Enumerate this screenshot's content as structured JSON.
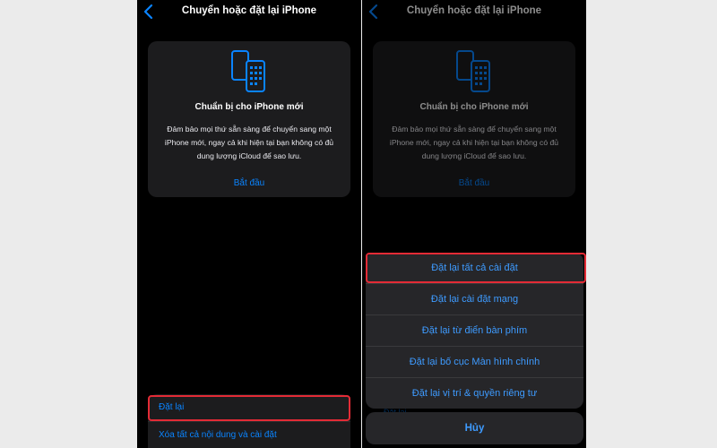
{
  "left": {
    "nav": {
      "title": "Chuyển hoặc đặt lại iPhone",
      "back_icon": "chevron-left-icon"
    },
    "card": {
      "icon": "phones-transfer-icon",
      "title": "Chuẩn bị cho iPhone mới",
      "description": "Đảm bảo mọi thứ sẵn sàng để chuyển sang một iPhone mới, ngay cả khi hiện tại bạn không có đủ dung lượng iCloud để sao lưu.",
      "action": "Bắt đầu"
    },
    "list": {
      "reset": "Đặt lại",
      "erase": "Xóa tất cả nội dung và cài đặt"
    }
  },
  "right": {
    "nav": {
      "title": "Chuyển hoặc đặt lại iPhone"
    },
    "card": {
      "title": "Chuẩn bị cho iPhone mới",
      "description": "Đảm bảo mọi thứ sẵn sàng để chuyển sang một iPhone mới, ngay cả khi hiện tại bạn không có đủ dung lượng iCloud để sao lưu.",
      "action": "Bắt đầu"
    },
    "peek": "Đặt lại",
    "sheet": {
      "items": [
        "Đặt lại tất cả cài đặt",
        "Đặt lại cài đặt mạng",
        "Đặt lại từ điển bàn phím",
        "Đặt lại bố cục Màn hình chính",
        "Đặt lại vị trí & quyền riêng tư"
      ],
      "cancel": "Hủy"
    }
  },
  "colors": {
    "accent": "#0a84ff",
    "highlight": "#e32b36",
    "card_bg": "#1c1c1e",
    "sheet_bg": "#262629"
  }
}
